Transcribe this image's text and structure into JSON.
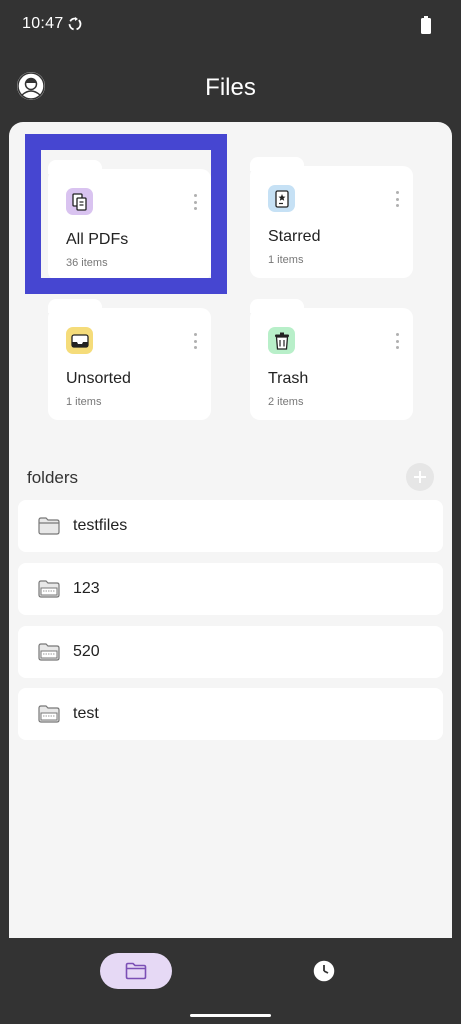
{
  "status_bar": {
    "time": "10:47"
  },
  "header": {
    "title": "Files",
    "avatar_icon": "user-avatar-icon"
  },
  "categories": [
    {
      "label": "All PDFs",
      "count": "36 items",
      "icon": "pdf-files-icon",
      "icon_bg": "#d9c3f0"
    },
    {
      "label": "Starred",
      "count": "1 items",
      "icon": "starred-document-icon",
      "icon_bg": "#c6e1f5"
    },
    {
      "label": "Unsorted",
      "count": "1 items",
      "icon": "inbox-tray-icon",
      "icon_bg": "#f5dc7a"
    },
    {
      "label": "Trash",
      "count": "2 items",
      "icon": "trash-can-icon",
      "icon_bg": "#b8efc9"
    }
  ],
  "folders_section": {
    "title": "folders",
    "add_icon": "plus-icon"
  },
  "folders": [
    {
      "name": "testfiles",
      "icon": "folder-icon"
    },
    {
      "name": "123",
      "icon": "folder-open-icon"
    },
    {
      "name": "520",
      "icon": "folder-open-icon"
    },
    {
      "name": "test",
      "icon": "folder-open-icon"
    }
  ],
  "bottom_nav": {
    "files_icon": "folder-nav-icon",
    "recent_icon": "clock-icon",
    "active_color": "#e6d9f5"
  },
  "colors": {
    "highlight": "#4646d1",
    "background": "#333333",
    "content_bg": "#f5f5f5"
  }
}
